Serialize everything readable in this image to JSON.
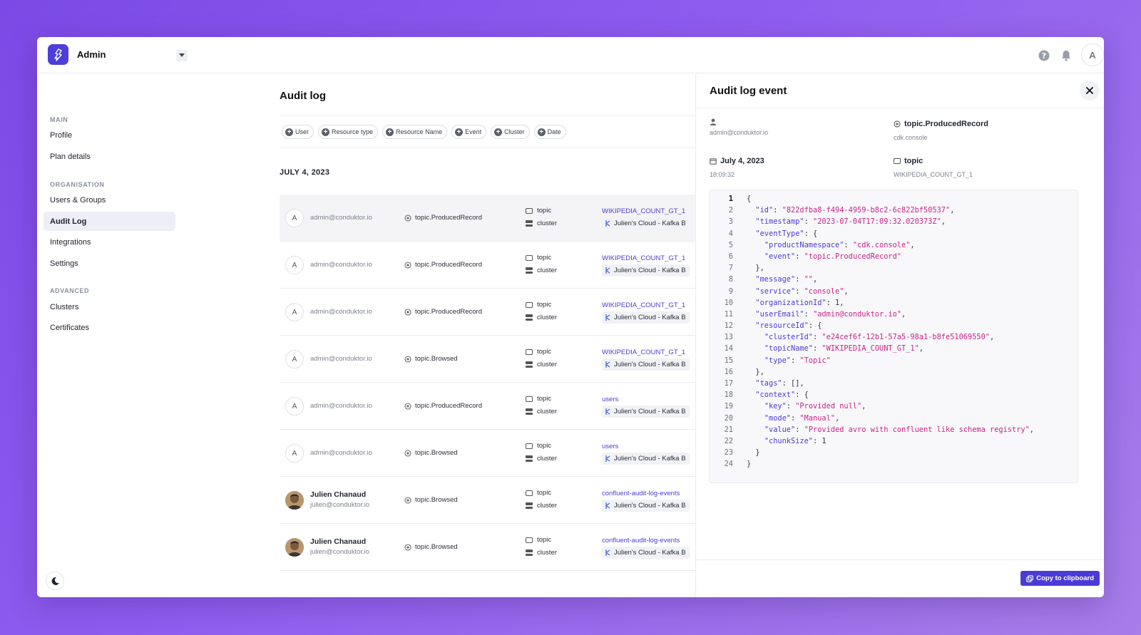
{
  "app": {
    "title": "Admin",
    "avatar_initial": "A"
  },
  "sidebar": {
    "sections": [
      {
        "label": "MAIN",
        "items": [
          {
            "label": "Profile"
          },
          {
            "label": "Plan details"
          }
        ]
      },
      {
        "label": "ORGANISATION",
        "items": [
          {
            "label": "Users & Groups"
          },
          {
            "label": "Audit Log",
            "active": true
          },
          {
            "label": "Integrations"
          },
          {
            "label": "Settings"
          }
        ]
      },
      {
        "label": "ADVANCED",
        "items": [
          {
            "label": "Clusters"
          },
          {
            "label": "Certificates"
          }
        ]
      }
    ]
  },
  "main": {
    "title": "Audit log",
    "filters": [
      "User",
      "Resource type",
      "Resource Name",
      "Event",
      "Cluster",
      "Date"
    ],
    "date_heading": "JULY 4, 2023",
    "rows": [
      {
        "avatar": "A",
        "name": "",
        "email": "admin@conduktor.io",
        "event": "topic.ProducedRecord",
        "type1": "topic",
        "type2": "cluster",
        "resource": "WIKIPEDIA_COUNT_GT_1",
        "cluster": "Julien's Cloud - Kafka B",
        "selected": true
      },
      {
        "avatar": "A",
        "name": "",
        "email": "admin@conduktor.io",
        "event": "topic.ProducedRecord",
        "type1": "topic",
        "type2": "cluster",
        "resource": "WIKIPEDIA_COUNT_GT_1",
        "cluster": "Julien's Cloud - Kafka B"
      },
      {
        "avatar": "A",
        "name": "",
        "email": "admin@conduktor.io",
        "event": "topic.ProducedRecord",
        "type1": "topic",
        "type2": "cluster",
        "resource": "WIKIPEDIA_COUNT_GT_1",
        "cluster": "Julien's Cloud - Kafka B"
      },
      {
        "avatar": "A",
        "name": "",
        "email": "admin@conduktor.io",
        "event": "topic.Browsed",
        "type1": "topic",
        "type2": "cluster",
        "resource": "WIKIPEDIA_COUNT_GT_1",
        "cluster": "Julien's Cloud - Kafka B"
      },
      {
        "avatar": "A",
        "name": "",
        "email": "admin@conduktor.io",
        "event": "topic.ProducedRecord",
        "type1": "topic",
        "type2": "cluster",
        "resource": "users",
        "cluster": "Julien's Cloud - Kafka B"
      },
      {
        "avatar": "A",
        "name": "",
        "email": "admin@conduktor.io",
        "event": "topic.Browsed",
        "type1": "topic",
        "type2": "cluster",
        "resource": "users",
        "cluster": "Julien's Cloud - Kafka B"
      },
      {
        "avatar": "photo",
        "name": "Julien Chanaud",
        "email": "julien@conduktor.io",
        "event": "topic.Browsed",
        "type1": "topic",
        "type2": "cluster",
        "resource": "confluent-audit-log-events",
        "cluster": "Julien's Cloud - Kafka B"
      },
      {
        "avatar": "photo",
        "name": "Julien Chanaud",
        "email": "julien@conduktor.io",
        "event": "topic.Browsed",
        "type1": "topic",
        "type2": "cluster",
        "resource": "confluent-audit-log-events",
        "cluster": "Julien's Cloud - Kafka B"
      }
    ]
  },
  "panel": {
    "title": "Audit log event",
    "user_email": "admin@conduktor.io",
    "event": "topic.ProducedRecord",
    "namespace": "cdk.console",
    "date": "July 4, 2023",
    "time": "18:09:32",
    "resource_type": "topic",
    "resource_name": "WIKIPEDIA_COUNT_GT_1",
    "copy_label": "Copy to clipboard",
    "json_lines": [
      "{",
      "  \"id\": \"822dfba8-f494-4959-b8c2-6c822bf50537\",",
      "  \"timestamp\": \"2023-07-04T17:09:32.020373Z\",",
      "  \"eventType\": {",
      "    \"productNamespace\": \"cdk.console\",",
      "    \"event\": \"topic.ProducedRecord\"",
      "  },",
      "  \"message\": \"\",",
      "  \"service\": \"console\",",
      "  \"organizationId\": 1,",
      "  \"userEmail\": \"admin@conduktor.io\",",
      "  \"resourceId\": {",
      "    \"clusterId\": \"e24cef6f-12b1-57a5-98a1-b8fe51069550\",",
      "    \"topicName\": \"WIKIPEDIA_COUNT_GT_1\",",
      "    \"type\": \"Topic\"",
      "  },",
      "  \"tags\": [],",
      "  \"context\": {",
      "    \"key\": \"Provided null\",",
      "    \"mode\": \"Manual\",",
      "    \"value\": \"Provided avro with confluent like schema registry\",",
      "    \"chunkSize\": 1",
      "  }",
      "}"
    ]
  },
  "colors": {
    "accent": "#4b3bd6",
    "json_key": "#4b3bd6",
    "json_string": "#c9248a"
  }
}
